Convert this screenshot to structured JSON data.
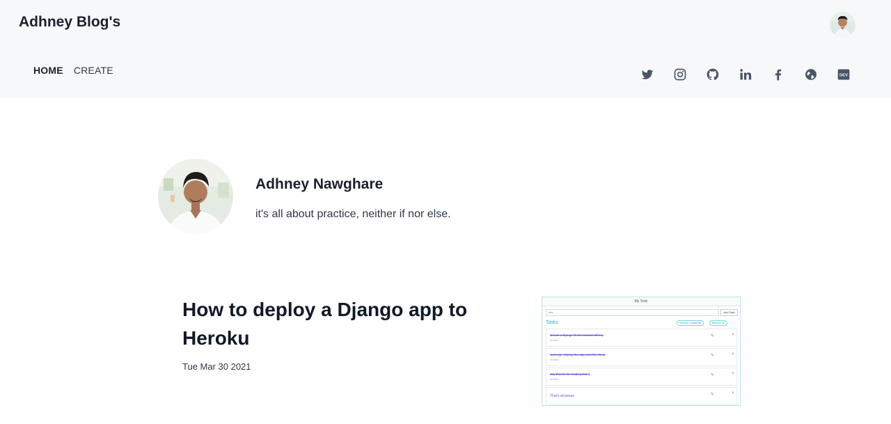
{
  "header": {
    "brand": "Adhney Blog's",
    "nav": [
      {
        "label": "HOME",
        "active": true
      },
      {
        "label": "CREATE",
        "active": false
      }
    ],
    "social_icons": [
      "twitter-icon",
      "instagram-icon",
      "github-icon",
      "linkedin-icon",
      "facebook-icon",
      "globe-icon",
      "dev-icon"
    ],
    "dev_badge": "DEV"
  },
  "profile": {
    "name": "Adhney Nawghare",
    "bio": "it's all about practice, neither if nor else."
  },
  "post": {
    "title": "How to deploy a Django app to Heroku",
    "date": "Tue Mar 30 2021",
    "thumbnail": {
      "app_title": "My Todo",
      "input_value": "test",
      "add_button": "Add Task",
      "tasks_heading": "Tasks",
      "pills": [
        "Remove Completed",
        "Remove All"
      ],
      "rows": [
        {
          "text": "Create a Django To-Do tutorial Adhney",
          "done": true,
          "sub": "Hi there"
        },
        {
          "text": "Next Up - deploy the app onto the cloud",
          "done": true,
          "sub": "Hi there"
        },
        {
          "text": "Say thanks for reading this :)",
          "done": true,
          "sub": "Hi there"
        },
        {
          "text": "That's all peeps",
          "done": false,
          "sub": ""
        }
      ]
    }
  },
  "colors": {
    "header_bg": "#f7f8fa",
    "text_primary": "#1a202c",
    "icon_gray": "#4a5568",
    "thumb_accent": "#28b5c9"
  }
}
